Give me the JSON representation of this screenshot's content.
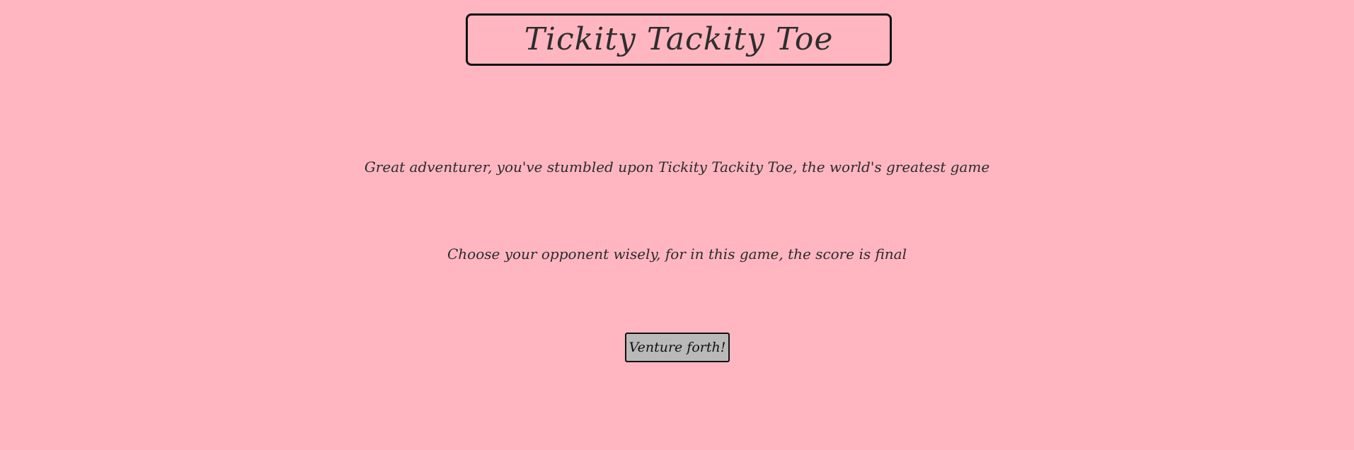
{
  "header": {
    "title": "Tickity Tackity Toe"
  },
  "intro": {
    "line1": "Great adventurer, you've stumbled upon Tickity Tackity Toe, the world's greatest game",
    "line2": "Choose your opponent wisely, for in this game, the score is final"
  },
  "actions": {
    "start_label": "Venture forth!"
  },
  "colors": {
    "background": "#ffb6c1",
    "button_background": "#b9b9b9",
    "border": "#111111",
    "text": "#2e2e2e"
  }
}
